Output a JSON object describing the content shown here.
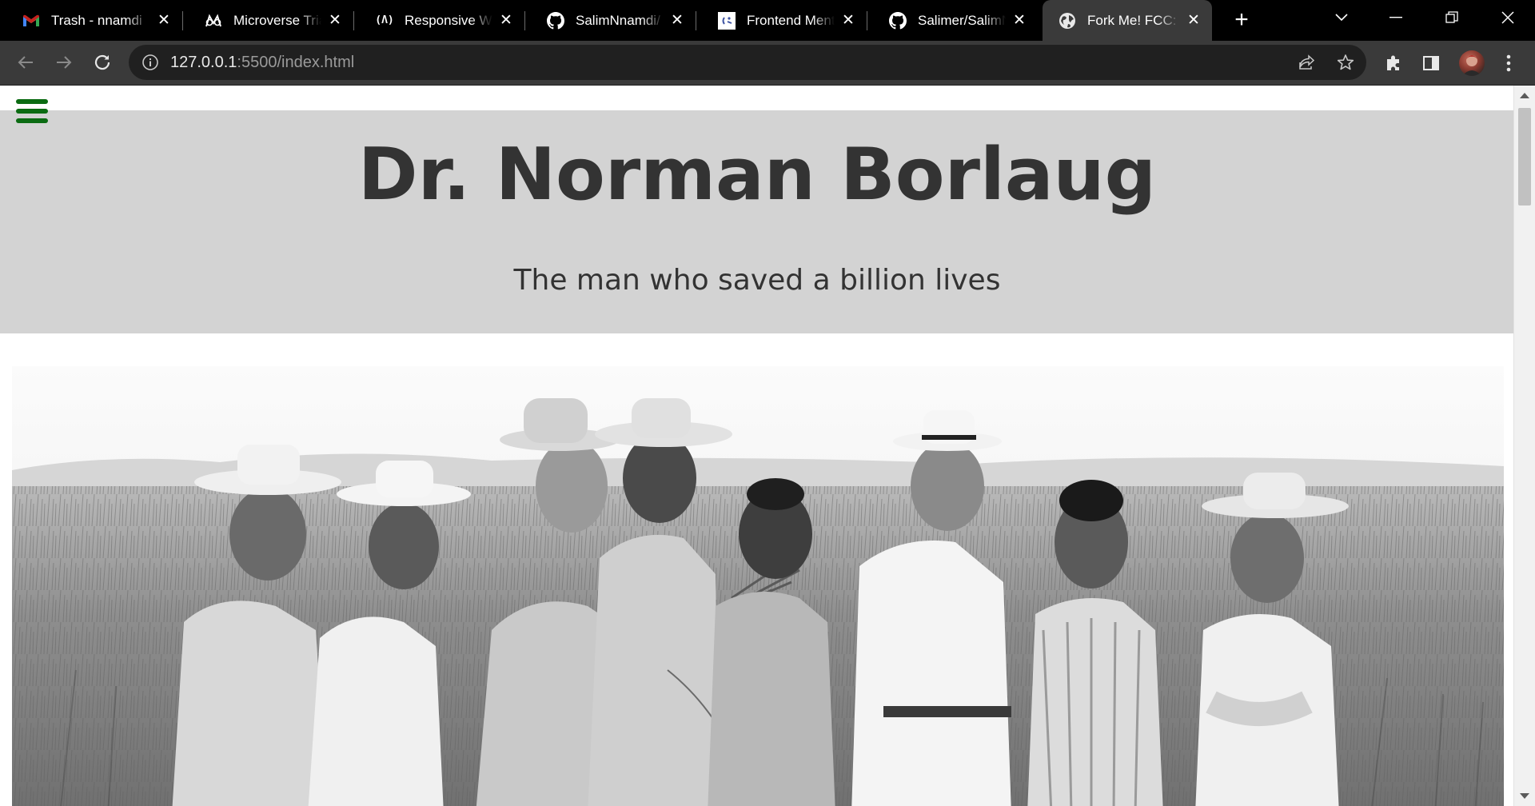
{
  "browser": {
    "tabs": [
      {
        "title": "Trash - nnamdi",
        "icon": "gmail-icon"
      },
      {
        "title": "Microverse Tria",
        "icon": "microverse-icon"
      },
      {
        "title": "Responsive We",
        "icon": "freecodecamp-icon"
      },
      {
        "title": "SalimNnamdi/",
        "icon": "github-icon"
      },
      {
        "title": "Frontend Ment",
        "icon": "frontend-mentor-icon"
      },
      {
        "title": "Salimer/SalimN",
        "icon": "github-icon"
      },
      {
        "title": "Fork Me! FCC:",
        "icon": "globe-icon",
        "active": true
      }
    ],
    "url_host": "127.0.0.1",
    "url_rest": ":5500/index.html"
  },
  "page": {
    "title": "Dr. Norman Borlaug",
    "subtitle": "The man who saved a billion lives",
    "image": {
      "subject": "group-photo-wheat-field",
      "colors": {
        "sky": "#f4f4f4",
        "field": "#8c8c8c",
        "shirts": "#e6e6e6"
      }
    },
    "colors": {
      "header_bg": "#d3d3d3",
      "title_text": "#333333",
      "menu_icon": "#0b6b12"
    }
  }
}
